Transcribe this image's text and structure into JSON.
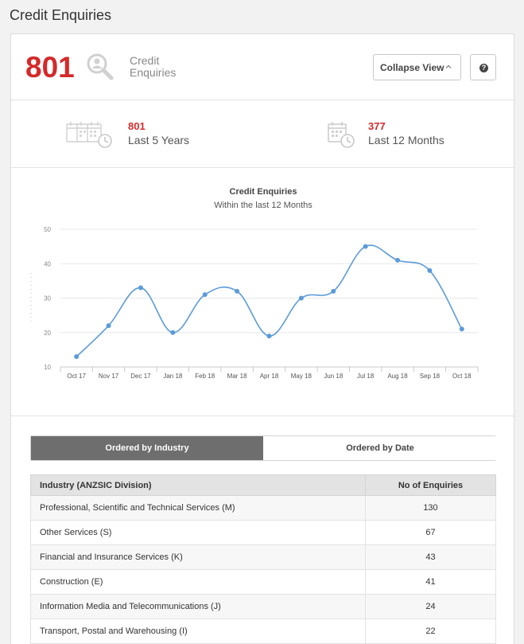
{
  "page": {
    "title": "Credit Enquiries"
  },
  "summary": {
    "total": "801",
    "label": "Credit Enquiries",
    "collapse_label": "Collapse View",
    "help_label": "?"
  },
  "stats": [
    {
      "value": "801",
      "label": "Last 5 Years"
    },
    {
      "value": "377",
      "label": "Last 12 Months"
    }
  ],
  "chart_data": {
    "type": "line",
    "title": "Credit Enquiries",
    "subtitle": "Within the last 12 Months",
    "categories": [
      "Oct 17",
      "Nov 17",
      "Dec 17",
      "Jan 18",
      "Feb 18",
      "Mar 18",
      "Apr 18",
      "May 18",
      "Jun 18",
      "Jul 18",
      "Aug 18",
      "Sep 18",
      "Oct 18"
    ],
    "series": [
      {
        "values": [
          13,
          22,
          33,
          20,
          31,
          32,
          19,
          30,
          32,
          45,
          41,
          38,
          21
        ]
      }
    ],
    "ylim": [
      10,
      50
    ],
    "yticks": [
      10,
      20,
      30,
      40,
      50
    ],
    "grid": true,
    "line_color": "#5b9bd9"
  },
  "tabs": [
    {
      "label": "Ordered by Industry",
      "active": true
    },
    {
      "label": "Ordered by Date",
      "active": false
    }
  ],
  "table": {
    "headers": [
      "Industry (ANZSIC Division)",
      "No of Enquiries"
    ],
    "rows": [
      [
        "Professional, Scientific and Technical Services (M)",
        "130"
      ],
      [
        "Other Services (S)",
        "67"
      ],
      [
        "Financial and Insurance Services (K)",
        "43"
      ],
      [
        "Construction (E)",
        "41"
      ],
      [
        "Information Media and Telecommunications (J)",
        "24"
      ],
      [
        "Transport, Postal and Warehousing (I)",
        "22"
      ]
    ]
  }
}
